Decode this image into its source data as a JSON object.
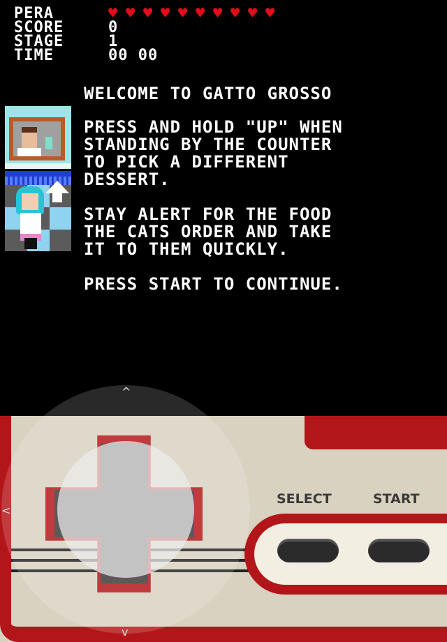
{
  "hud": {
    "player_label": "PERA",
    "hearts": 10,
    "score_label": "SCORE",
    "score_value": "0",
    "stage_label": "STAGE",
    "stage_value": "1",
    "time_label": "TIME",
    "time_value": "00 00"
  },
  "intro": {
    "title": "WELCOME TO GATTO GROSSO",
    "instruction_1": "PRESS AND HOLD \"UP\" WHEN\nSTANDING BY THE COUNTER\nTO PICK A DIFFERENT\nDESSERT.",
    "instruction_2": "STAY ALERT FOR THE FOOD\nTHE CATS ORDER AND TAKE\nIT TO THEM QUICKLY.",
    "instruction_3": "PRESS START TO CONTINUE."
  },
  "controller": {
    "select_label": "SELECT",
    "start_label": "START"
  },
  "joystick": {
    "up": "^",
    "down": "v",
    "left": "<",
    "right": ">"
  },
  "colors": {
    "heart": "#e30d18",
    "controller_red": "#b3161a",
    "controller_body": "#d8d2c0",
    "background": "#000000"
  }
}
